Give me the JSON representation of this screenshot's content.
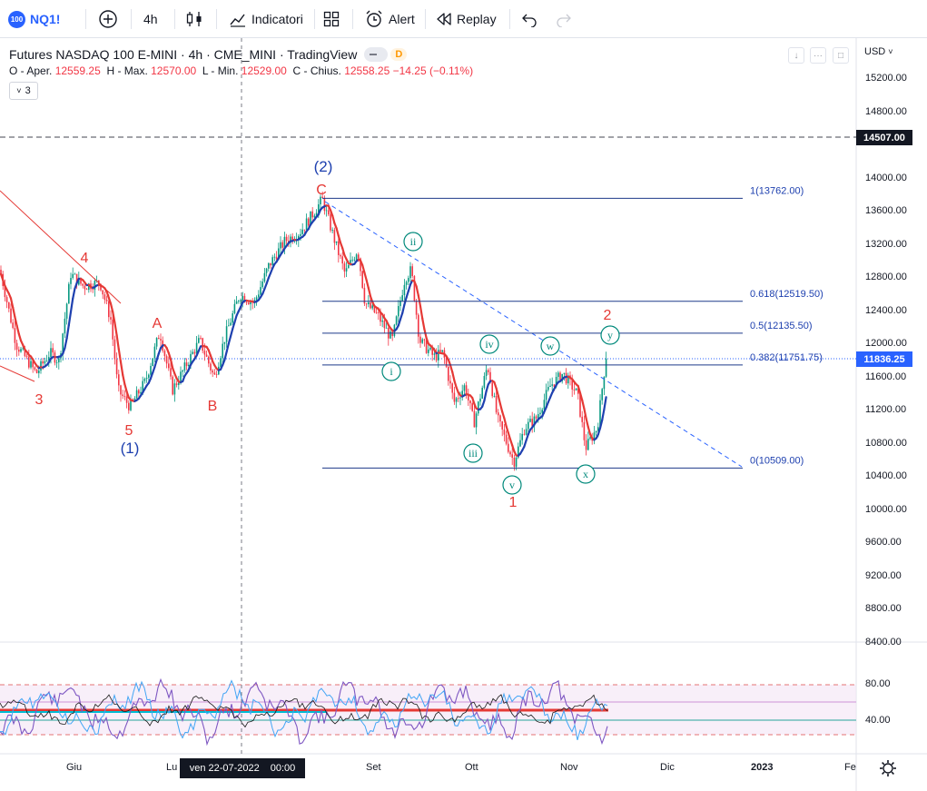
{
  "toolbar": {
    "symbol_badge": "100",
    "symbol": "NQ1!",
    "interval": "4h",
    "indicators_label": "Indicatori",
    "alert_label": "Alert",
    "replay_label": "Replay"
  },
  "legend": {
    "title": "Futures NASDAQ 100 E-MINI · 4h · CME_MINI · TradingView",
    "d_badge": "D",
    "open_label": "O - Aper.",
    "open": "12559.25",
    "high_label": "H - Max.",
    "high": "12570.00",
    "low_label": "L - Min.",
    "low": "12529.00",
    "close_label": "C - Chius.",
    "close": "12558.25",
    "change": "−14.25 (−0.11%)",
    "indicator_count": "3"
  },
  "price_axis": {
    "currency": "USD",
    "labels": [
      "15200.00",
      "14800.00",
      "14000.00",
      "13600.00",
      "13200.00",
      "12800.00",
      "12400.00",
      "12000.00",
      "11600.00",
      "11200.00",
      "10800.00",
      "10400.00",
      "10000.00",
      "9600.00",
      "9200.00",
      "8800.00",
      "8400.00"
    ],
    "alert_tag": "14507.00",
    "last_price_tag": "11836.25",
    "rsi_labels": [
      "80.00",
      "40.00"
    ]
  },
  "time_axis": {
    "labels": [
      "Giu",
      "Lu",
      "Set",
      "Ott",
      "Nov",
      "Dic",
      "2023",
      "Fe"
    ],
    "crosshair_date": "ven 22-07-2022",
    "crosshair_time": "00:00"
  },
  "fib_levels": [
    {
      "label": "1(13762.00)",
      "price": 13762
    },
    {
      "label": "0.618(12519.50)",
      "price": 12519.5
    },
    {
      "label": "0.5(12135.50)",
      "price": 12135.5
    },
    {
      "label": "0.382(11751.75)",
      "price": 11751.75
    },
    {
      "label": "0(10509.00)",
      "price": 10509
    }
  ],
  "wave_labels": {
    "red": [
      "4",
      "3",
      "5",
      "A",
      "B",
      "C",
      "2",
      "1"
    ],
    "blue": [
      "(1)",
      "(2)"
    ],
    "circled": [
      "ii",
      "i",
      "iv",
      "w",
      "y",
      "iii",
      "x",
      "v"
    ]
  },
  "colors": {
    "accent": "#2962ff",
    "down": "#f23645",
    "up": "#089981",
    "fib": "#1e3a8a",
    "wave_red": "#e53935",
    "wave_blue": "#1e40af",
    "wave_teal": "#00897b"
  }
}
